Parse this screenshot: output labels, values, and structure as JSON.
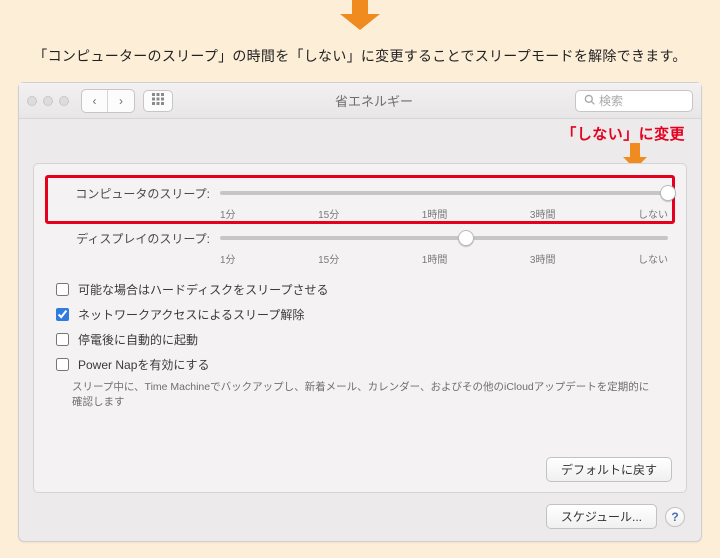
{
  "intro_text": "「コンピューターのスリープ」の時間を「しない」に変更することでスリープモードを解除できます。",
  "callout": {
    "label": "「しない」に変更"
  },
  "window": {
    "title": "省エネルギー",
    "search_placeholder": "検索"
  },
  "sliders": {
    "ticks": [
      "1分",
      "15分",
      "1時間",
      "3時間",
      "しない"
    ],
    "computer": {
      "label": "コンピュータのスリープ:",
      "position_percent": 100
    },
    "display": {
      "label": "ディスプレイのスリープ:",
      "position_percent": 55
    }
  },
  "options": {
    "hdd_sleep": {
      "label": "可能な場合はハードディスクをスリープさせる",
      "checked": false
    },
    "wake_on_lan": {
      "label": "ネットワークアクセスによるスリープ解除",
      "checked": true
    },
    "auto_restart": {
      "label": "停電後に自動的に起動",
      "checked": false
    },
    "power_nap": {
      "label": "Power Napを有効にする",
      "checked": false,
      "desc": "スリープ中に、Time Machineでバックアップし、新着メール、カレンダー、およびその他のiCloudアップデートを定期的に確認します"
    }
  },
  "buttons": {
    "restore_defaults": "デフォルトに戻す",
    "schedule": "スケジュール...",
    "help_glyph": "?"
  }
}
